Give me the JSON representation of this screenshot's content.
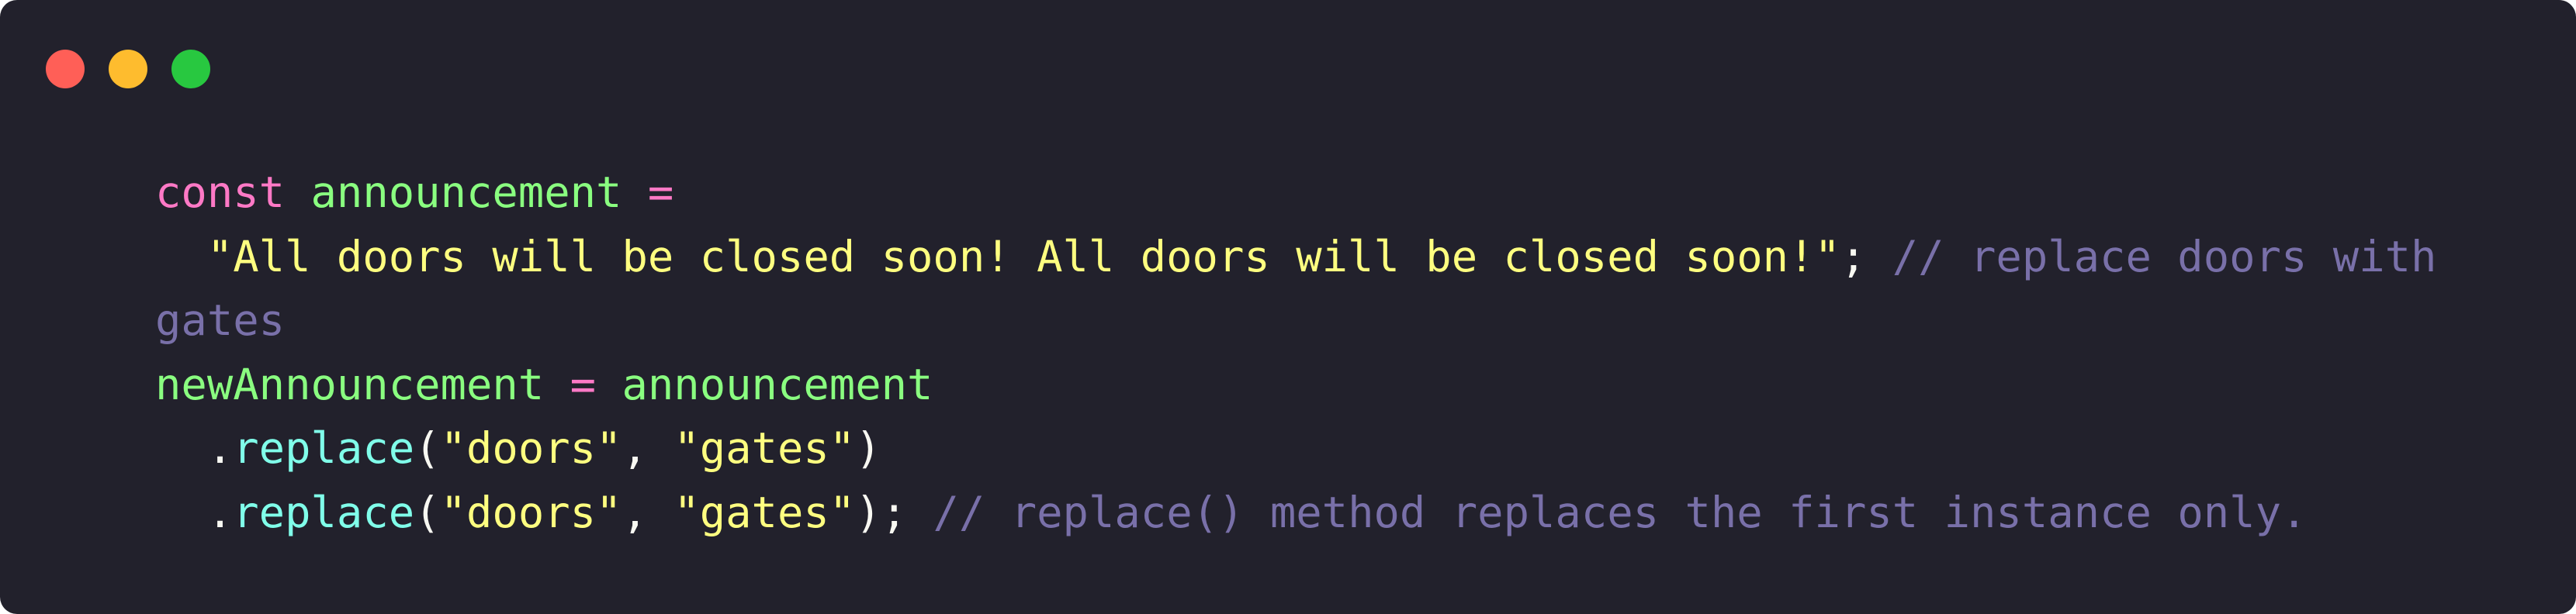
{
  "window": {
    "controls": {
      "close_color": "#ff5f57",
      "minimize_color": "#febc2e",
      "maximize_color": "#28c840"
    }
  },
  "code": {
    "line1": {
      "keyword": "const",
      "name": "announcement",
      "op": "="
    },
    "line2": {
      "indent": "  ",
      "string": "\"All doors will be closed soon! All doors will be closed soon!\"",
      "semi": ";",
      "comment": "// replace doors with"
    },
    "line3": {
      "comment": "gates"
    },
    "line4": {
      "name": "newAnnouncement",
      "op": "=",
      "value": "announcement"
    },
    "line5": {
      "indent": "  ",
      "dot": ".",
      "method": "replace",
      "open": "(",
      "arg1": "\"doors\"",
      "comma": ", ",
      "arg2": "\"gates\"",
      "close": ")"
    },
    "line6": {
      "indent": "  ",
      "dot": ".",
      "method": "replace",
      "open": "(",
      "arg1": "\"doors\"",
      "comma": ", ",
      "arg2": "\"gates\"",
      "close": ");",
      "comment": "// replace() method replaces the first instance only."
    }
  }
}
